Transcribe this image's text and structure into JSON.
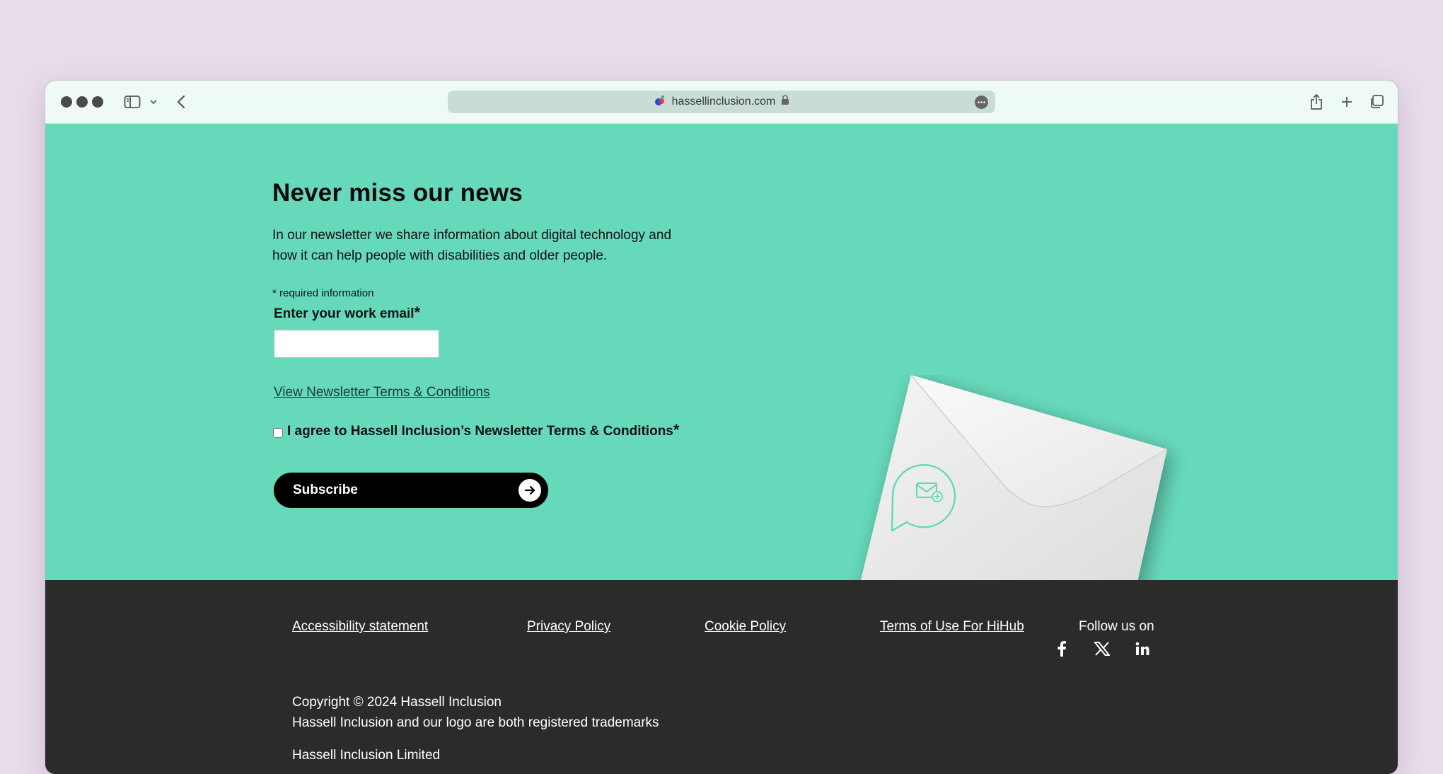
{
  "browser": {
    "url": "hassellinclusion.com"
  },
  "newsletter": {
    "title": "Never miss our news",
    "intro": "In our newsletter we share information about digital technology and how it can help people with disabilities and older people.",
    "required_note": "* required information",
    "email_label": "Enter your work email",
    "required_marker": "*",
    "email_value": "",
    "terms_link": "View Newsletter Terms & Conditions",
    "agree_label": "I agree to Hassell Inclusion’s Newsletter Terms & Conditions",
    "agree_checked": false,
    "subscribe_label": "Subscribe"
  },
  "footer": {
    "links": [
      "Accessibility statement",
      "Privacy Policy",
      "Cookie Policy",
      "Terms of Use For HiHub"
    ],
    "follow_label": "Follow us on",
    "social": [
      "facebook-icon",
      "x-icon",
      "linkedin-icon"
    ],
    "copyright": "Copyright © 2024 Hassell Inclusion",
    "trademark": "Hassell Inclusion and our logo are both registered trademarks",
    "company": "Hassell Inclusion Limited"
  },
  "colors": {
    "hero_bg": "#67d9bb",
    "footer_bg": "#2b2b2b",
    "button_bg": "#000000",
    "page_bg": "#e8dcea"
  }
}
